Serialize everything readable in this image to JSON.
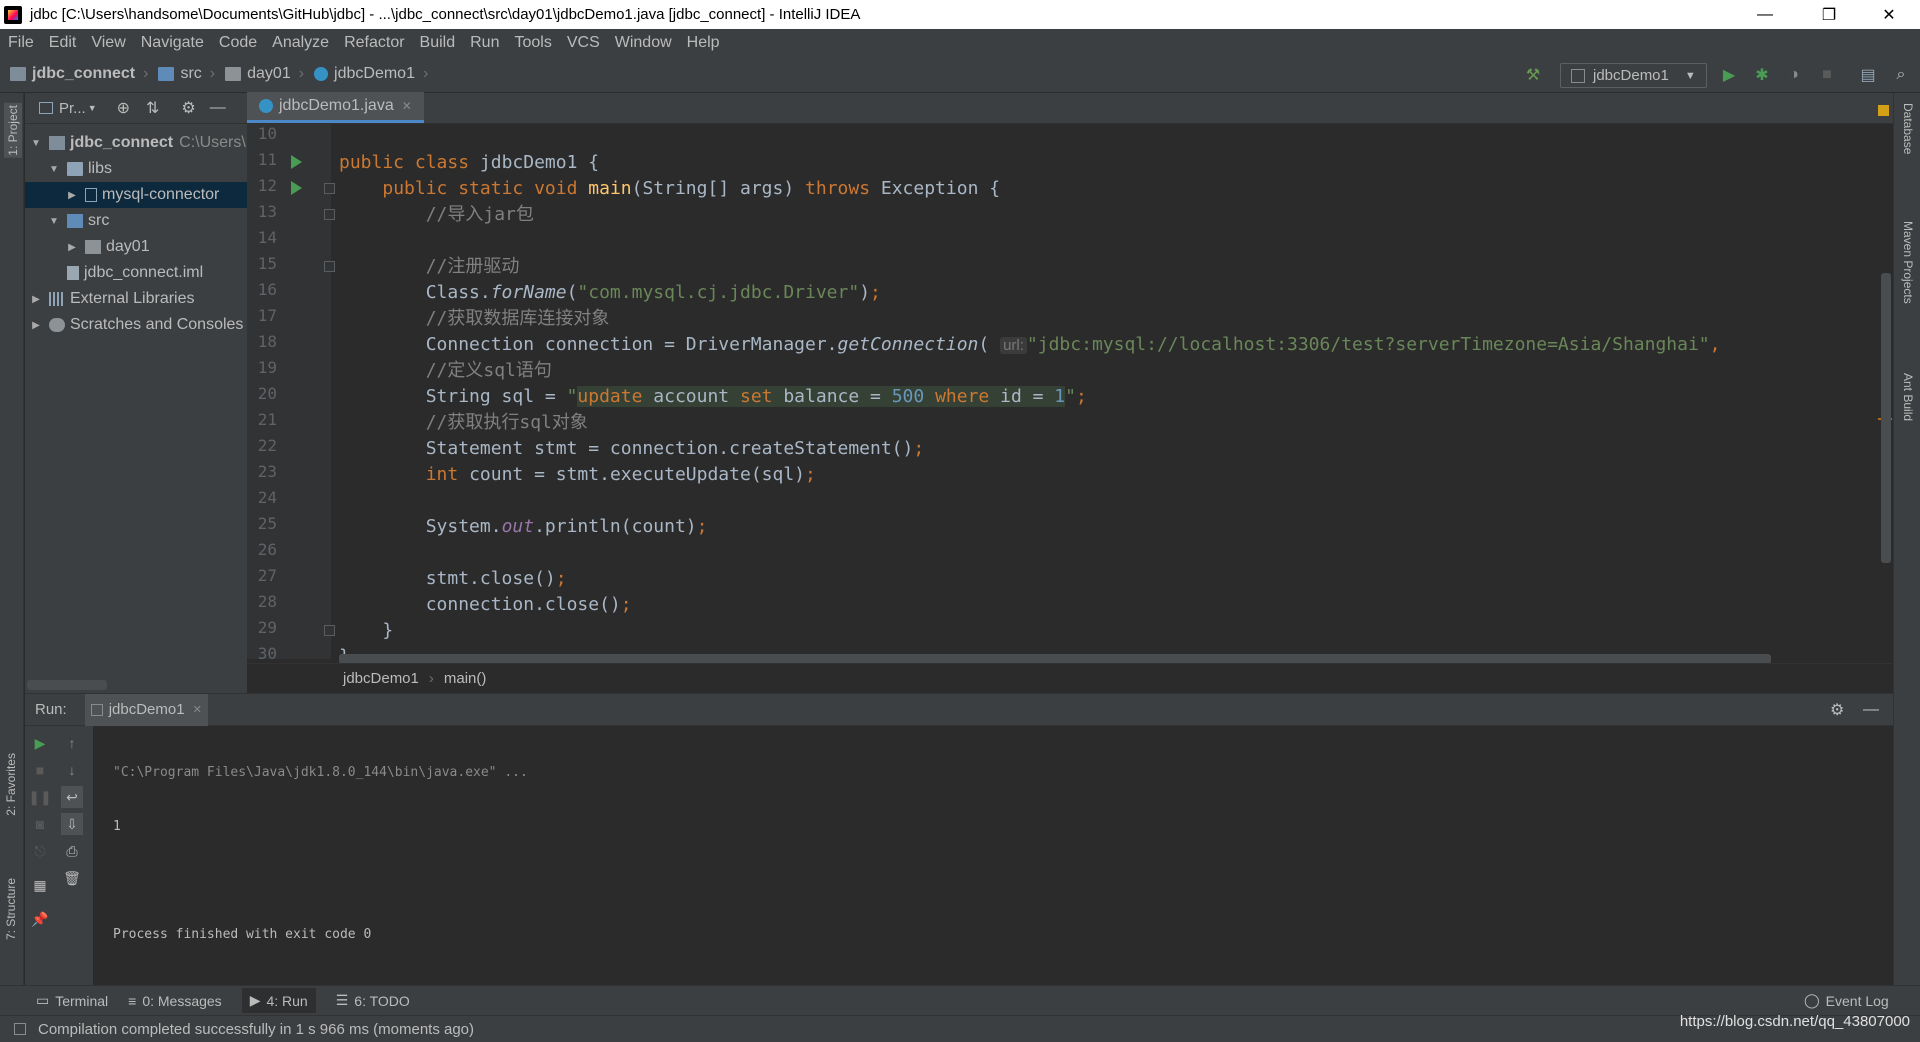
{
  "window": {
    "title": "jdbc [C:\\Users\\handsome\\Documents\\GitHub\\jdbc] - ...\\jdbc_connect\\src\\day01\\jdbcDemo1.java [jdbc_connect] - IntelliJ IDEA",
    "minimize": "—",
    "restore": "❐",
    "close": "✕"
  },
  "menu": [
    "File",
    "Edit",
    "View",
    "Navigate",
    "Code",
    "Analyze",
    "Refactor",
    "Build",
    "Run",
    "Tools",
    "VCS",
    "Window",
    "Help"
  ],
  "breadcrumbs": [
    "jdbc_connect",
    "src",
    "day01",
    "jdbcDemo1"
  ],
  "run_config": "jdbcDemo1",
  "left_strip": {
    "project": "1: Project",
    "favorites": "2: Favorites",
    "structure": "7: Structure"
  },
  "right_strip": {
    "database": "Database",
    "maven": "Maven Projects",
    "ant": "Ant Build"
  },
  "project_panel": {
    "title": "Pr...",
    "tree": [
      {
        "label": "jdbc_connect",
        "suffix": "C:\\Users\\",
        "depth": 0,
        "expanded": true,
        "icon": "module-icon"
      },
      {
        "label": "libs",
        "depth": 1,
        "expanded": true,
        "icon": "folder-icon"
      },
      {
        "label": "mysql-connector",
        "depth": 2,
        "expanded": false,
        "icon": "jar-icon",
        "selected": true
      },
      {
        "label": "src",
        "depth": 1,
        "expanded": true,
        "icon": "source-folder-icon"
      },
      {
        "label": "day01",
        "depth": 2,
        "expanded": false,
        "icon": "package-icon"
      },
      {
        "label": "jdbc_connect.iml",
        "depth": 1,
        "icon": "iml-file-icon"
      },
      {
        "label": "External Libraries",
        "depth": 0,
        "expanded": false,
        "icon": "libraries-icon"
      },
      {
        "label": "Scratches and Consoles",
        "depth": 0,
        "expanded": false,
        "icon": "scratches-icon"
      }
    ]
  },
  "editor": {
    "tab": "jdbcDemo1.java",
    "line_numbers": [
      "10",
      "11",
      "12",
      "13",
      "14",
      "15",
      "16",
      "17",
      "18",
      "19",
      "20",
      "21",
      "22",
      "23",
      "24",
      "25",
      "26",
      "27",
      "28",
      "29",
      "30"
    ],
    "breadcrumb": [
      "jdbcDemo1",
      "main()"
    ],
    "inlay_hint": "url:"
  },
  "run_panel": {
    "label": "Run:",
    "tab": "jdbcDemo1",
    "console": [
      "\"C:\\Program Files\\Java\\jdk1.8.0_144\\bin\\java.exe\" ...",
      "1",
      "",
      "Process finished with exit code 0"
    ]
  },
  "bottom_tools": [
    {
      "label": "Terminal",
      "icon": "terminal-icon"
    },
    {
      "label": "0: Messages",
      "icon": "messages-icon"
    },
    {
      "label": "4: Run",
      "icon": "run-icon",
      "active": true
    },
    {
      "label": "6: TODO",
      "icon": "todo-icon"
    }
  ],
  "event_log": "Event Log",
  "status": {
    "message": "Compilation completed successfully in 1 s 966 ms (moments ago)",
    "watermark": "https://blog.csdn.net/qq_43807000"
  }
}
